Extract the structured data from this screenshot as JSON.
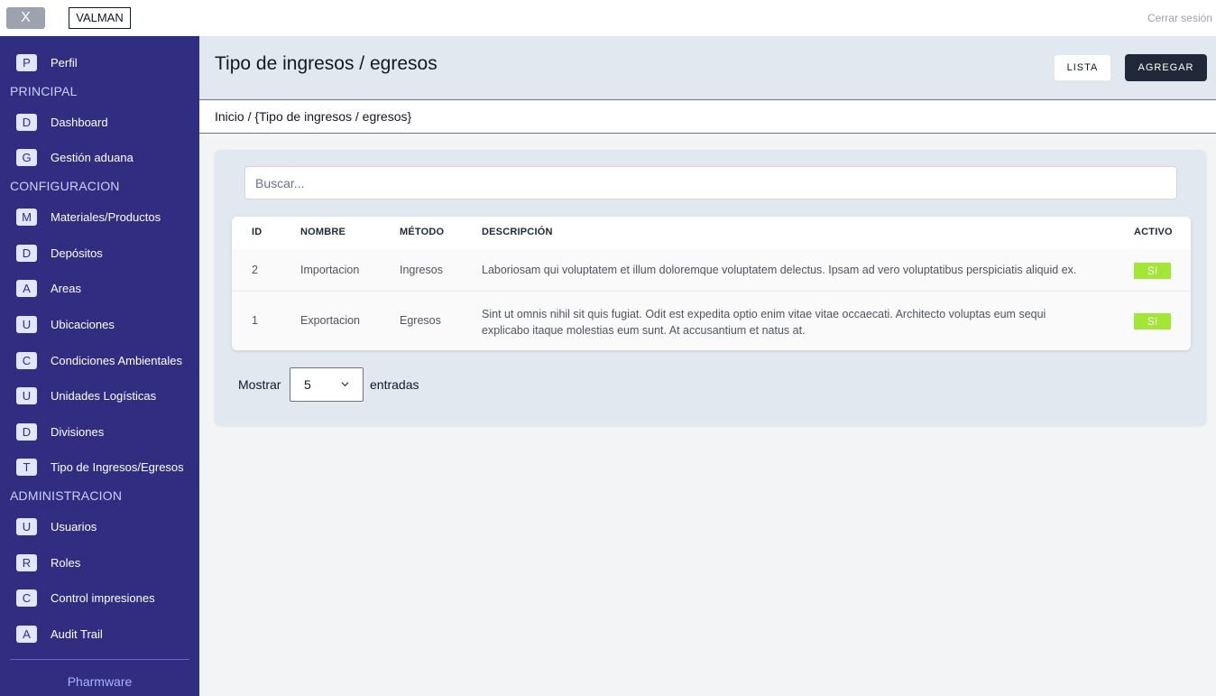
{
  "topbar": {
    "close_label": "X",
    "brand": "VALMAN",
    "logout": "Cerrar sesión"
  },
  "sidebar": {
    "profile": {
      "badge": "P",
      "label": "Perfil"
    },
    "sections": [
      {
        "title": "PRINCIPAL",
        "items": [
          {
            "badge": "D",
            "label": "Dashboard"
          },
          {
            "badge": "G",
            "label": "Gestión aduana"
          }
        ]
      },
      {
        "title": "CONFIGURACION",
        "items": [
          {
            "badge": "M",
            "label": "Materiales/Productos"
          },
          {
            "badge": "D",
            "label": "Depósitos"
          },
          {
            "badge": "A",
            "label": "Areas"
          },
          {
            "badge": "U",
            "label": "Ubicaciones"
          },
          {
            "badge": "C",
            "label": "Condiciones Ambientales"
          },
          {
            "badge": "U",
            "label": "Unidades Logísticas"
          },
          {
            "badge": "D",
            "label": "Divisiones"
          },
          {
            "badge": "T",
            "label": "Tipo de Ingresos/Egresos"
          }
        ]
      },
      {
        "title": "ADMINISTRACION",
        "items": [
          {
            "badge": "U",
            "label": "Usuarios"
          },
          {
            "badge": "R",
            "label": "Roles"
          },
          {
            "badge": "C",
            "label": "Control impresiones"
          },
          {
            "badge": "A",
            "label": "Audit Trail"
          }
        ]
      }
    ],
    "footer": "Pharmware"
  },
  "header": {
    "title": "Tipo de ingresos / egresos",
    "lista_label": "LISTA",
    "agregar_label": "AGREGAR"
  },
  "breadcrumb": "Inicio / {Tipo de ingresos / egresos}",
  "search": {
    "placeholder": "Buscar...",
    "value": ""
  },
  "table": {
    "headers": {
      "id": "ID",
      "nombre": "NOMBRE",
      "metodo": "MÉTODO",
      "descripcion": "DESCRIPCIÓN",
      "activo": "ACTIVO"
    },
    "rows": [
      {
        "id": "2",
        "nombre": "Importacion",
        "metodo": "Ingresos",
        "descripcion": "Laboriosam qui voluptatem et illum doloremque voluptatem delectus. Ipsam ad vero voluptatibus perspiciatis aliquid ex.",
        "activo": "Sí"
      },
      {
        "id": "1",
        "nombre": "Exportacion",
        "metodo": "Egresos",
        "descripcion": "Sint ut omnis nihil sit quis fugiat. Odit est expedita optio enim vitae vitae occaecati. Architecto voluptas eum sequi explicabo itaque molestias eum sunt. At accusantium et natus at.",
        "activo": "Sí"
      }
    ]
  },
  "pagination": {
    "show_label": "Mostrar",
    "page_size": "5",
    "entries_label": "entradas"
  },
  "colors": {
    "sidebar_bg": "#312e81",
    "active_badge": "#a3e635",
    "primary_button": "#1f2937"
  }
}
